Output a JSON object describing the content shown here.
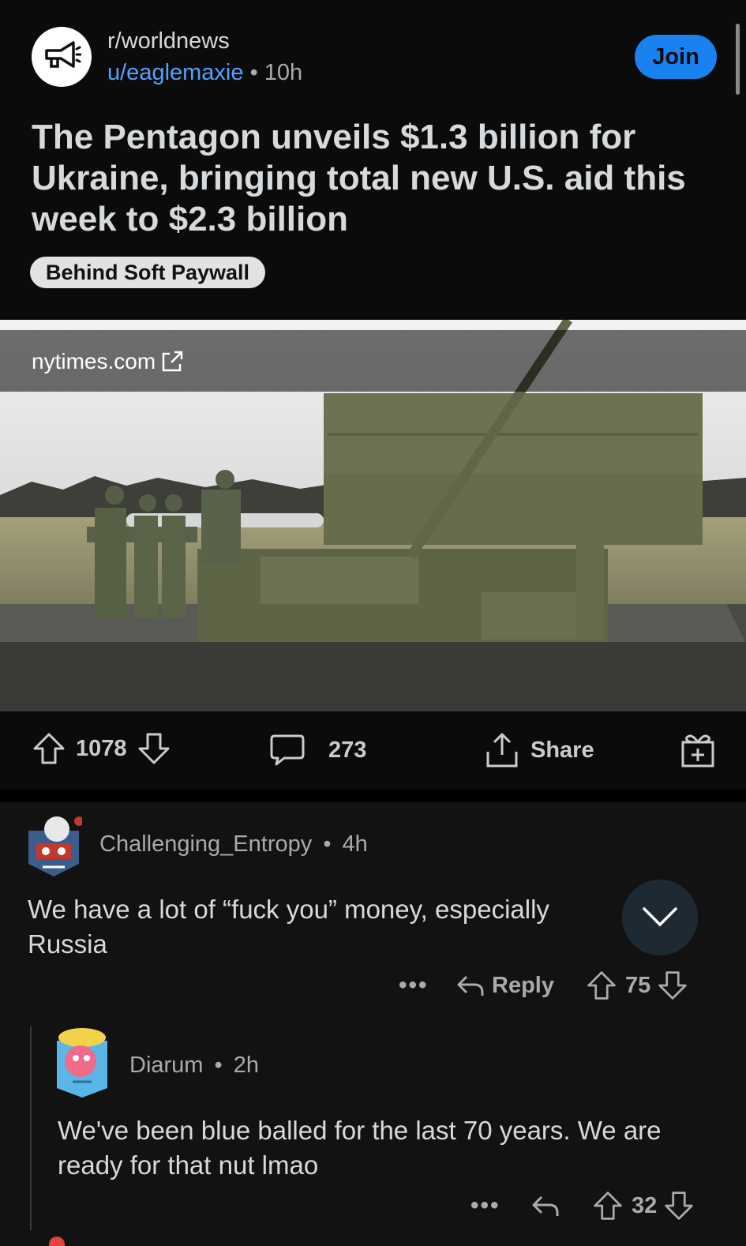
{
  "post": {
    "subreddit": "r/worldnews",
    "author": "u/eaglemaxie",
    "age": "10h",
    "separator": "•",
    "join_label": "Join",
    "title": "The Pentagon unveils $1.3 billion for Ukraine, bringing total new U.S. aid this week to $2.3 billion",
    "flair": "Behind Soft Paywall",
    "link_domain": "nytimes.com",
    "upvotes": "1078",
    "comments": "273",
    "share_label": "Share"
  },
  "comments": [
    {
      "author": "Challenging_Entropy",
      "age": "4h",
      "body": "We have a lot of “fuck you” money, especially",
      "body_line2": "Russia",
      "reply_label": "Reply",
      "votes": "75"
    },
    {
      "author": "Diarum",
      "age": "2h",
      "body": "We've been blue balled for the last 70 years. We are ready for that nut lmao",
      "votes": "32"
    }
  ],
  "colors": {
    "accent": "#1a82f0",
    "username": "#4fa3ff",
    "background": "#0b0b0b",
    "comment_bg": "#121212"
  },
  "icons": {
    "subreddit": "megaphone-icon",
    "external_link": "external-link-icon",
    "upvote": "up-arrow-icon",
    "downvote": "down-arrow-icon",
    "comment": "comment-bubble-icon",
    "share": "share-icon",
    "award": "gift-icon",
    "reply": "reply-arrow-icon",
    "more": "more-dots-icon",
    "collapse": "chevron-down-icon"
  }
}
